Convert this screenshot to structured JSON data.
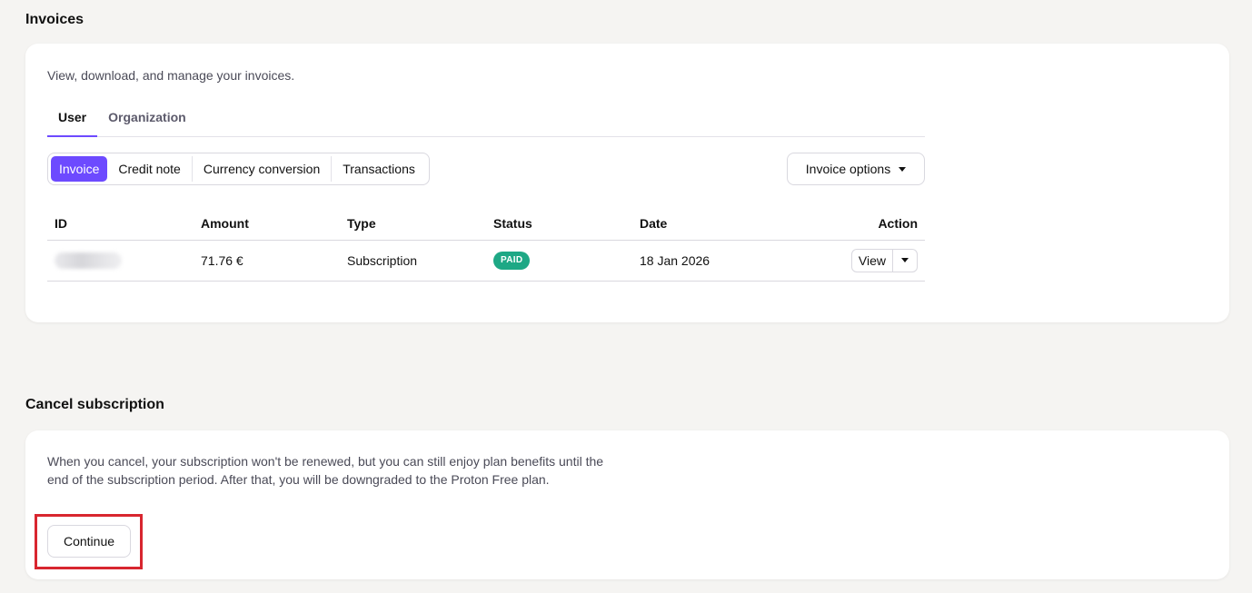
{
  "invoices": {
    "title": "Invoices",
    "description": "View, download, and manage your invoices.",
    "tabs": [
      {
        "label": "User",
        "active": true
      },
      {
        "label": "Organization",
        "active": false
      }
    ],
    "segments": [
      {
        "label": "Invoice",
        "active": true
      },
      {
        "label": "Credit note",
        "active": false
      },
      {
        "label": "Currency conversion",
        "active": false
      },
      {
        "label": "Transactions",
        "active": false
      }
    ],
    "options_label": "Invoice options",
    "table": {
      "headers": [
        "ID",
        "Amount",
        "Type",
        "Status",
        "Date",
        "Action"
      ],
      "rows": [
        {
          "id": "",
          "amount": "71.76 €",
          "type": "Subscription",
          "status": "PAID",
          "date": "18 Jan 2026",
          "action": "View"
        }
      ]
    }
  },
  "cancel": {
    "title": "Cancel subscription",
    "description": "When you cancel, your subscription won't be renewed, but you can still enjoy plan benefits until the end of the subscription period. After that, you will be downgraded to the Proton Free plan.",
    "continue_label": "Continue"
  },
  "colors": {
    "accent": "#6d4aff",
    "paid_badge": "#1ea885",
    "highlight": "#d8262f"
  }
}
